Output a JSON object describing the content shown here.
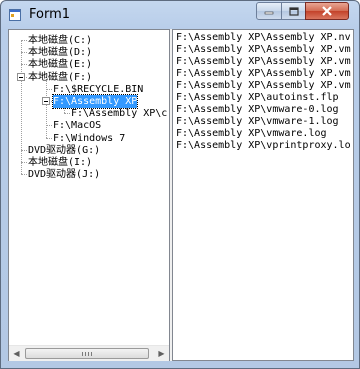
{
  "window": {
    "title": "Form1"
  },
  "icons": {
    "app": "form-icon",
    "minimize": "minimize-icon",
    "maximize": "maximize-icon",
    "close": "close-icon"
  },
  "tree": {
    "items": [
      {
        "label": "本地磁盘(C:)",
        "level": 0
      },
      {
        "label": "本地磁盘(D:)",
        "level": 0
      },
      {
        "label": "本地磁盘(E:)",
        "level": 0
      },
      {
        "label": "本地磁盘(F:)",
        "level": 0,
        "expanded": true
      },
      {
        "label": "F:\\$RECYCLE.BIN",
        "level": 1
      },
      {
        "label": "F:\\Assembly XP",
        "level": 1,
        "expanded": true,
        "selected": true
      },
      {
        "label": "F:\\Assembly XP\\c",
        "level": 2
      },
      {
        "label": "F:\\MacOS",
        "level": 1
      },
      {
        "label": "F:\\Windows 7",
        "level": 1
      },
      {
        "label": "DVD驱动器(G:)",
        "level": 0
      },
      {
        "label": "本地磁盘(I:)",
        "level": 0
      },
      {
        "label": "DVD驱动器(J:)",
        "level": 0
      }
    ]
  },
  "files": [
    "F:\\Assembly XP\\Assembly XP.nv",
    "F:\\Assembly XP\\Assembly XP.vm",
    "F:\\Assembly XP\\Assembly XP.vm",
    "F:\\Assembly XP\\Assembly XP.vm",
    "F:\\Assembly XP\\Assembly XP.vm",
    "F:\\Assembly XP\\autoinst.flp",
    "F:\\Assembly XP\\vmware-0.log",
    "F:\\Assembly XP\\vmware-1.log",
    "F:\\Assembly XP\\vmware.log",
    "F:\\Assembly XP\\vprintproxy.lo"
  ]
}
